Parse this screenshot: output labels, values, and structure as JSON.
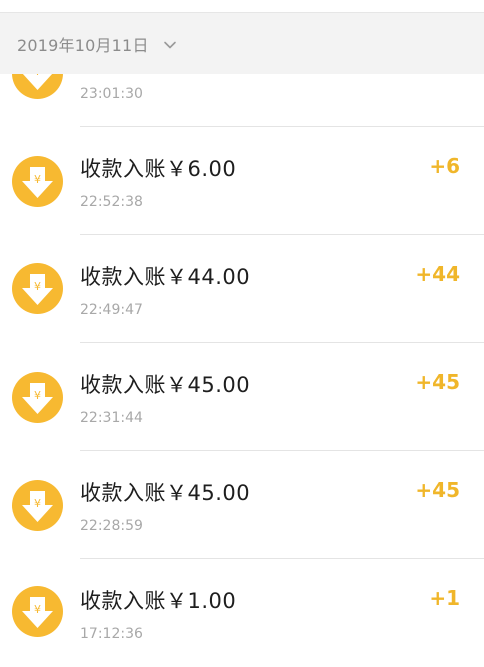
{
  "header": {
    "date": "2019年10月11日"
  },
  "colors": {
    "accent": "#f7b931",
    "amount": "#f0b62a"
  },
  "transactions": [
    {
      "title": "",
      "time": "23:01:30",
      "amount": ""
    },
    {
      "title": "收款入账￥6.00",
      "time": "22:52:38",
      "amount": "+6"
    },
    {
      "title": "收款入账￥44.00",
      "time": "22:49:47",
      "amount": "+44"
    },
    {
      "title": "收款入账￥45.00",
      "time": "22:31:44",
      "amount": "+45"
    },
    {
      "title": "收款入账￥45.00",
      "time": "22:28:59",
      "amount": "+45"
    },
    {
      "title": "收款入账￥1.00",
      "time": "17:12:36",
      "amount": "+1"
    }
  ],
  "icons": {
    "transaction": "yuan-down-arrow-icon",
    "expand": "chevron-down-icon"
  }
}
